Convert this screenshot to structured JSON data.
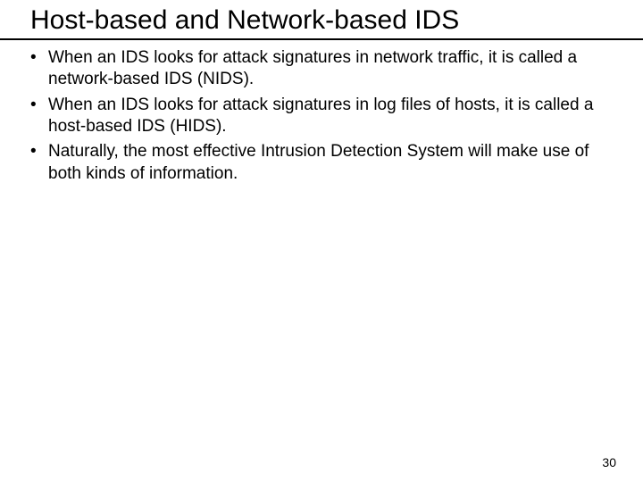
{
  "title": "Host-based and Network-based IDS",
  "bullets": [
    "When an IDS looks for attack signatures in network traffic, it is called a network-based IDS (NIDS).",
    "When an IDS looks for attack signatures in log files of hosts, it is called a host-based IDS (HIDS).",
    "Naturally, the most effective Intrusion Detection System will make use of both kinds of information."
  ],
  "page_number": "30"
}
